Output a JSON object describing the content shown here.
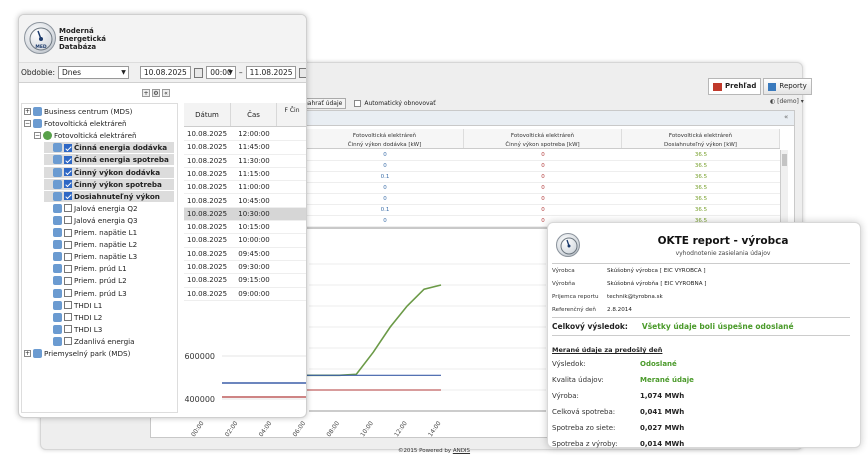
{
  "app": {
    "logo_lines": [
      "Moderná",
      "Energetická",
      "Databáza"
    ],
    "logo_badge": "MED"
  },
  "period": {
    "label": "Obdobie:",
    "value": "Dnes",
    "from_date": "10.08.2025",
    "from_time": "00:00",
    "separator": "–",
    "to_date": "11.08.2025"
  },
  "tree_toolbar": [
    "+",
    "⚙",
    "«"
  ],
  "tree": [
    {
      "label": "Business centrum (MDS)",
      "level": 0,
      "kind": "site",
      "expand": "+"
    },
    {
      "label": "Fotovoltická elektráreň",
      "level": 0,
      "kind": "site",
      "expand": "−"
    },
    {
      "label": "Fotovoltická elektráreň",
      "level": 1,
      "kind": "plant",
      "expand": "−"
    },
    {
      "label": "Činná energia dodávka",
      "level": 2,
      "checked": true,
      "bold": true
    },
    {
      "label": "Činná energia spotreba",
      "level": 2,
      "checked": true,
      "bold": true
    },
    {
      "label": "Činný výkon dodávka",
      "level": 2,
      "checked": true,
      "bold": true
    },
    {
      "label": "Činný výkon spotreba",
      "level": 2,
      "checked": true,
      "bold": true
    },
    {
      "label": "Dosiahnuteľný výkon",
      "level": 2,
      "checked": true,
      "bold": true
    },
    {
      "label": "Jalová energia Q2",
      "level": 2,
      "checked": false
    },
    {
      "label": "Jalová energia Q3",
      "level": 2,
      "checked": false
    },
    {
      "label": "Priem. napätie L1",
      "level": 2,
      "checked": false
    },
    {
      "label": "Priem. napätie L2",
      "level": 2,
      "checked": false
    },
    {
      "label": "Priem. napätie L3",
      "level": 2,
      "checked": false
    },
    {
      "label": "Priem. prúd L1",
      "level": 2,
      "checked": false
    },
    {
      "label": "Priem. prúd L2",
      "level": 2,
      "checked": false
    },
    {
      "label": "Priem. prúd L3",
      "level": 2,
      "checked": false
    },
    {
      "label": "THDI L1",
      "level": 2,
      "checked": false
    },
    {
      "label": "THDI L2",
      "level": 2,
      "checked": false
    },
    {
      "label": "THDI L3",
      "level": 2,
      "checked": false
    },
    {
      "label": "Zdanlivá energia",
      "level": 2,
      "checked": false
    },
    {
      "label": "Priemyselný park (MDS)",
      "level": 0,
      "kind": "site",
      "expand": "+"
    }
  ],
  "date_grid": {
    "headers": [
      "Dátum",
      "Čas",
      "F Čin"
    ],
    "rows": [
      [
        "10.08.2025",
        "12:00:00"
      ],
      [
        "10.08.2025",
        "11:45:00"
      ],
      [
        "10.08.2025",
        "11:30:00"
      ],
      [
        "10.08.2025",
        "11:15:00"
      ],
      [
        "10.08.2025",
        "11:00:00"
      ],
      [
        "10.08.2025",
        "10:45:00"
      ],
      [
        "10.08.2025",
        "10:30:00"
      ],
      [
        "10.08.2025",
        "10:15:00"
      ],
      [
        "10.08.2025",
        "10:00:00"
      ],
      [
        "10.08.2025",
        "09:45:00"
      ],
      [
        "10.08.2025",
        "09:30:00"
      ],
      [
        "10.08.2025",
        "09:15:00"
      ],
      [
        "10.08.2025",
        "09:00:00"
      ]
    ],
    "selected_index": 6
  },
  "left_chart": {
    "y_ticks": [
      "600000",
      "400000"
    ]
  },
  "bg_window": {
    "tabs": [
      "Prehľad",
      "Reporty"
    ],
    "user": "demo",
    "toolbar_button": "nahrať údaje",
    "auto_refresh": "Automatický obnovovať",
    "columns": [
      {
        "title": "Fotovoltická elektráreň",
        "sub": "Činný výkon dodávka [kW]"
      },
      {
        "title": "Fotovoltická elektráreň",
        "sub": "Činný výkon spotreba [kW]"
      },
      {
        "title": "Fotovoltická elektráreň",
        "sub": "Dosiahnuteľný výkon [kW]"
      }
    ],
    "rows": [
      [
        "0",
        "0",
        "36.5"
      ],
      [
        "0",
        "0",
        "36.5"
      ],
      [
        "0.1",
        "0",
        "36.5"
      ],
      [
        "0",
        "0",
        "36.5"
      ],
      [
        "0",
        "0",
        "36.5"
      ],
      [
        "0.1",
        "0",
        "36.5"
      ],
      [
        "0",
        "0",
        "36.5"
      ]
    ],
    "footer": "©2015 Powered by",
    "footer_link": "ANDIS"
  },
  "chart_data": {
    "type": "line",
    "x": [
      "06:00",
      "07:00",
      "08:00",
      "09:00",
      "10:00",
      "11:00",
      "12:00",
      "13:00",
      "14:00"
    ],
    "series": [
      {
        "values": [
          470000,
          470000,
          470000,
          475000,
          580000,
          700000,
          800000,
          880000,
          900000
        ]
      },
      {
        "values": [
          470000,
          470000,
          470000,
          470000,
          470000,
          470000,
          470000,
          470000,
          470000
        ]
      },
      {
        "values": [
          400000,
          400000,
          400000,
          400000,
          400000,
          400000,
          400000,
          400000,
          400000
        ]
      }
    ],
    "x_tick_labels": [
      "00:00",
      "02:00",
      "04:00",
      "06:00",
      "08:00",
      "10:00",
      "12:00",
      "14:00"
    ],
    "ylim": [
      300000,
      1000000
    ],
    "grid": true
  },
  "report": {
    "title": "OKTE report - výrobca",
    "subtitle": "vyhodnotenie zasielania údajov",
    "fields": [
      {
        "k": "Výrobca",
        "v": "Skúšobný výrobca [ EIC VYROBCA ]"
      },
      {
        "k": "Výrobňa",
        "v": "Skúšobná výrobňa [ EIC VYROBNA ]"
      },
      {
        "k": "Prijemca reportu",
        "v": "technik@tyrobna.sk"
      },
      {
        "k": "Referenčný deň",
        "v": "2.8.2014"
      }
    ],
    "overall_label": "Celkový výsledok:",
    "overall_value": "Všetky údaje boli úspešne odoslané",
    "measured_title": "Merané údaje za predošlý deň",
    "measured": [
      {
        "k": "Výsledok:",
        "v": "Odoslané",
        "green": true
      },
      {
        "k": "Kvalita údajov:",
        "v": "Merané údaje",
        "green": true
      },
      {
        "k": "Výroba:",
        "v": "1,074 MWh"
      },
      {
        "k": "Celková spotreba:",
        "v": "0,041 MWh"
      },
      {
        "k": "Spotreba zo siete:",
        "v": "0,027 MWh"
      },
      {
        "k": "Spotreba z výroby:",
        "v": "0,014 MWh"
      }
    ]
  }
}
